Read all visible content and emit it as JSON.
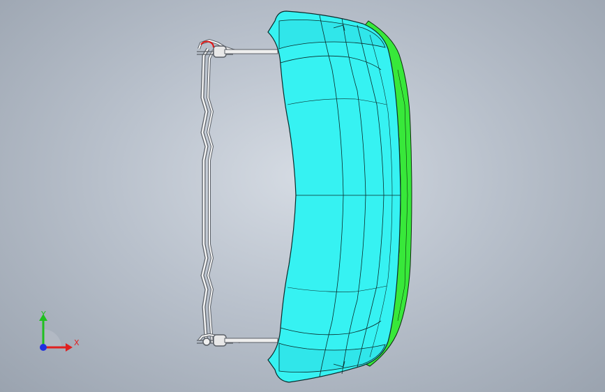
{
  "viewport": {
    "background_top": "#d5dbe3",
    "background_bottom": "#9aa3af"
  },
  "model": {
    "body_color": "#36f2f2",
    "edge_color": "#0a2a2a",
    "flange_color": "#38e83a",
    "frame_color": "#f4f4f4",
    "clip_highlight_color": "#e01818"
  },
  "triad": {
    "x_label": "X",
    "y_label": "Y",
    "x_color": "#e02020",
    "y_color": "#20c020",
    "z_color": "#2030e0"
  }
}
